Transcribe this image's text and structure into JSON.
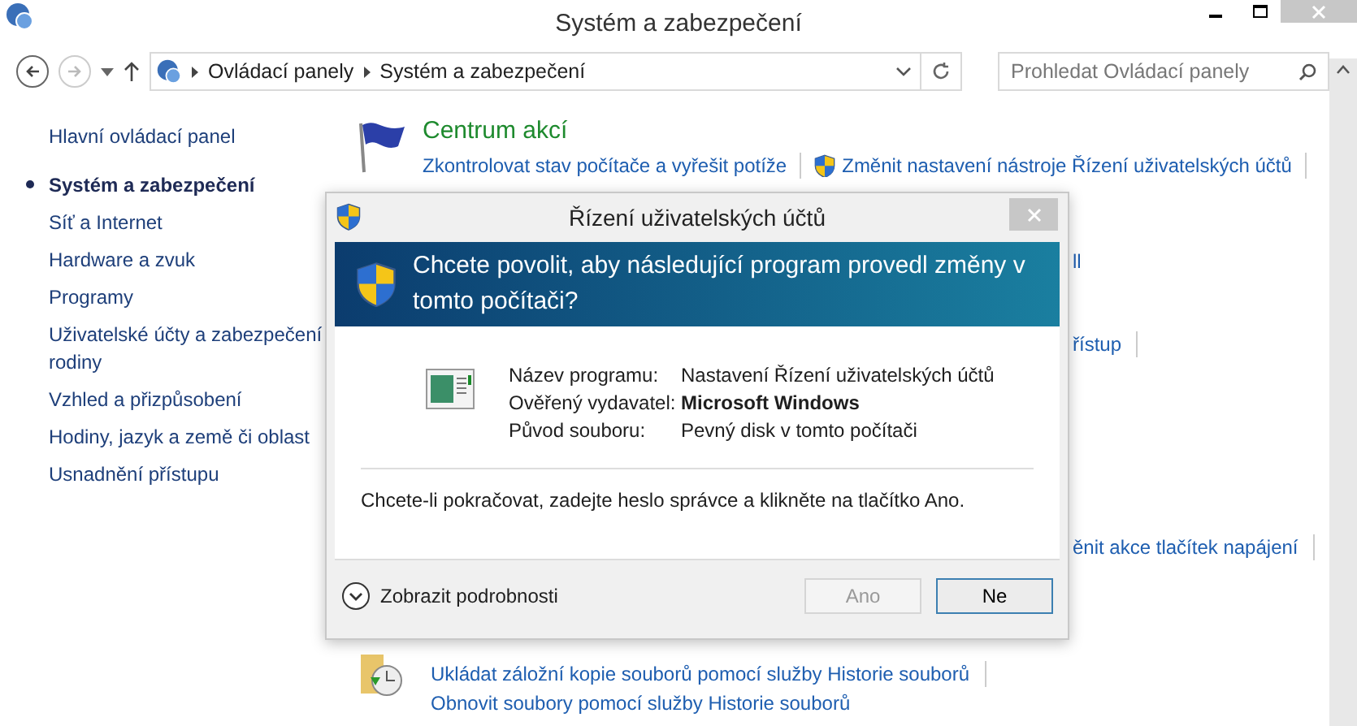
{
  "window": {
    "title": "Systém a zabezpečení"
  },
  "breadcrumb": [
    "Ovládací panely",
    "Systém a zabezpečení"
  ],
  "search": {
    "placeholder": "Prohledat Ovládací panely"
  },
  "sidebar": {
    "items": [
      {
        "label": "Hlavní ovládací panel",
        "selected": false
      },
      {
        "label": "Systém a zabezpečení",
        "selected": true
      },
      {
        "label": "Síť a Internet",
        "selected": false
      },
      {
        "label": "Hardware a zvuk",
        "selected": false
      },
      {
        "label": "Programy",
        "selected": false
      },
      {
        "label": "Uživatelské účty a zabezpečení rodiny",
        "selected": false
      },
      {
        "label": "Vzhled a přizpůsobení",
        "selected": false
      },
      {
        "label": "Hodiny, jazyk a země či oblast",
        "selected": false
      },
      {
        "label": "Usnadnění přístupu",
        "selected": false
      }
    ]
  },
  "action_center": {
    "title": "Centrum akcí",
    "links": [
      "Zkontrolovat stav počítače a vyřešit potíže",
      "Změnit nastavení nástroje Řízení uživatelských účtů"
    ]
  },
  "partial_links": [
    "ll",
    "řístup",
    "ěnit akce tlačítek napájení"
  ],
  "file_history": {
    "links": [
      "Ukládat záložní kopie souborů pomocí služby Historie souborů",
      "Obnovit soubory pomocí služby Historie souborů"
    ]
  },
  "dialog": {
    "title": "Řízení uživatelských účtů",
    "heading": "Chcete povolit, aby následující program provedl změny v tomto počítači?",
    "fields": [
      {
        "label": "Název programu:",
        "value": "Nastavení Řízení uživatelských účtů",
        "bold": false
      },
      {
        "label": "Ověřený vydavatel:",
        "value": "Microsoft Windows",
        "bold": true
      },
      {
        "label": "Původ souboru:",
        "value": "Pevný disk v tomto počítači",
        "bold": false
      }
    ],
    "message": "Chcete-li pokračovat, zadejte heslo správce a klikněte na tlačítko Ano.",
    "details": "Zobrazit podrobnosti",
    "buttons": [
      {
        "label": "Ano",
        "disabled": true
      },
      {
        "label": "Ne",
        "disabled": false
      }
    ]
  }
}
